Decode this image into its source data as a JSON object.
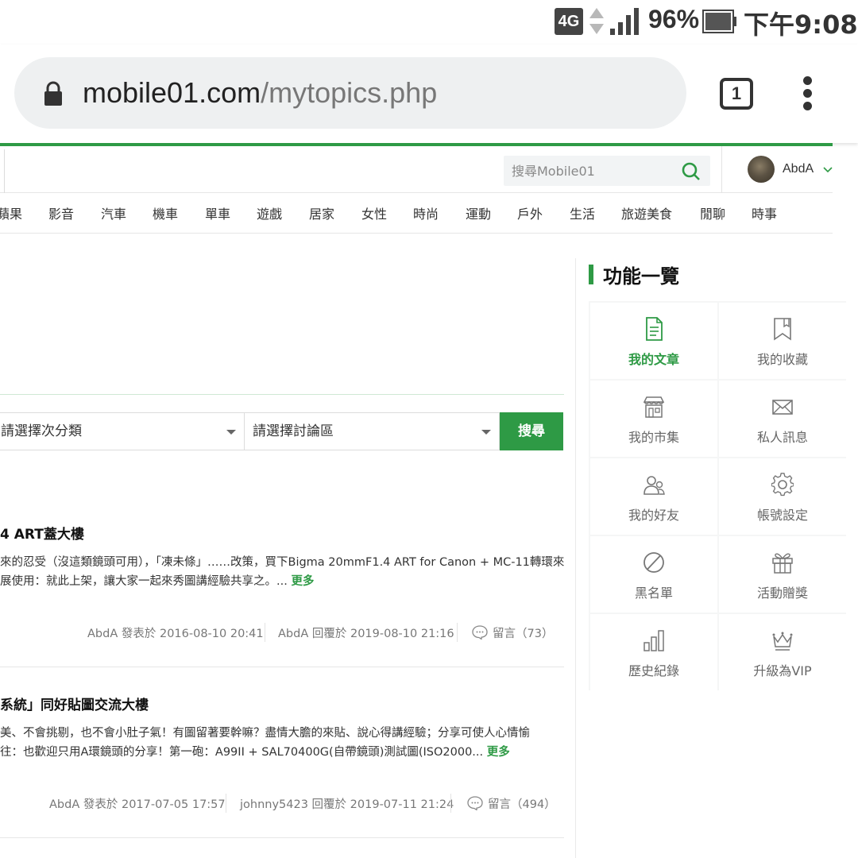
{
  "status_bar": {
    "network": "4G",
    "battery": "96%",
    "time": "下午9:08"
  },
  "browser": {
    "url_host": "mobile01.com",
    "url_path": "/mytopics.php",
    "tab_count": "1"
  },
  "header": {
    "search_placeholder": "搜尋Mobile01",
    "user_name": "AbdA",
    "accent_color": "#2e9a45"
  },
  "nav": {
    "categories": [
      "蘋果",
      "影音",
      "汽車",
      "機車",
      "單車",
      "遊戲",
      "居家",
      "女性",
      "時尚",
      "運動",
      "戶外",
      "生活",
      "旅遊美食",
      "閒聊",
      "時事"
    ]
  },
  "filters": {
    "subcategory": "請選擇次分類",
    "forum": "請選擇討論區",
    "search_button": "搜尋"
  },
  "topics": [
    {
      "title": "4 ART蓋大樓",
      "excerpt_lines": [
        "來的忍受（沒這類鏡頭可用），「凍未條」……改策，買下Bigma 20mmF1.4 ART for Canon + MC-11轉環來",
        "展使用：就此上架，讓大家一起來秀圖講經驗共享之。..."
      ],
      "more": "更多",
      "posted": "AbdA 發表於 2016-08-10 20:41",
      "replied": "AbdA 回覆於 2019-08-10 21:16",
      "comments": "留言（73）"
    },
    {
      "title": "系統」同好貼圖交流大樓",
      "excerpt_lines": [
        "美、不會挑剔，也不會小肚子氣！有圖留著要幹嘛？盡情大膽的來貼、說心得講經驗；分享可使人心情愉",
        "往：也歡迎只用A環鏡頭的分享！第一砲：A99II + SAL70400G(自帶鏡頭)測試圖(ISO2000..."
      ],
      "more": "更多",
      "posted": "AbdA 發表於 2017-07-05 17:57",
      "replied": "johnny5423 回覆於 2019-07-11 21:24",
      "comments": "留言（494）"
    }
  ],
  "sidebar": {
    "title": "功能一覽",
    "items": [
      {
        "label": "我的文章",
        "icon": "document-icon",
        "active": true
      },
      {
        "label": "我的收藏",
        "icon": "bookmark-icon",
        "active": false
      },
      {
        "label": "我的市集",
        "icon": "store-icon",
        "active": false
      },
      {
        "label": "私人訊息",
        "icon": "envelope-icon",
        "active": false
      },
      {
        "label": "我的好友",
        "icon": "friends-icon",
        "active": false
      },
      {
        "label": "帳號設定",
        "icon": "gear-icon",
        "active": false
      },
      {
        "label": "黑名單",
        "icon": "block-icon",
        "active": false
      },
      {
        "label": "活動贈獎",
        "icon": "gift-icon",
        "active": false
      },
      {
        "label": "歷史紀錄",
        "icon": "bar-chart-icon",
        "active": false
      },
      {
        "label": "升級為VIP",
        "icon": "crown-icon",
        "active": false
      }
    ]
  }
}
